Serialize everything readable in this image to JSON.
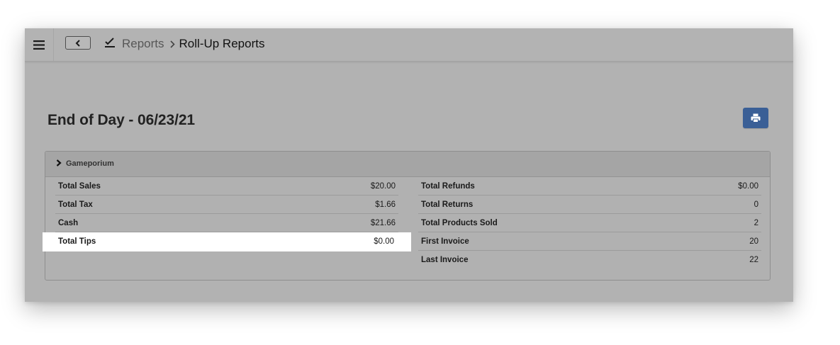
{
  "header": {
    "breadcrumb_parent": "Reports",
    "breadcrumb_current": "Roll-Up Reports"
  },
  "page": {
    "title": "End of Day - 06/23/21"
  },
  "panel": {
    "store_name": "Gameporium",
    "left_rows": [
      {
        "label": "Total Sales",
        "value": "$20.00"
      },
      {
        "label": "Total Tax",
        "value": "$1.66"
      },
      {
        "label": "Cash",
        "value": "$21.66"
      },
      {
        "label": "Total Tips",
        "value": "$0.00"
      }
    ],
    "right_rows": [
      {
        "label": "Total Refunds",
        "value": "$0.00"
      },
      {
        "label": "Total Returns",
        "value": "0"
      },
      {
        "label": "Total Products Sold",
        "value": "2"
      },
      {
        "label": "First Invoice",
        "value": "20"
      },
      {
        "label": "Last Invoice",
        "value": "22"
      }
    ]
  },
  "icons": {
    "menu": "hamburger-menu-icon",
    "back": "chevron-left-icon",
    "reports": "chart-check-icon",
    "separator": "chevron-right-icon",
    "print": "printer-icon",
    "expand": "chevron-right-icon"
  },
  "colors": {
    "print_button": "#3a5f96",
    "highlight_row": "#ffffff"
  }
}
